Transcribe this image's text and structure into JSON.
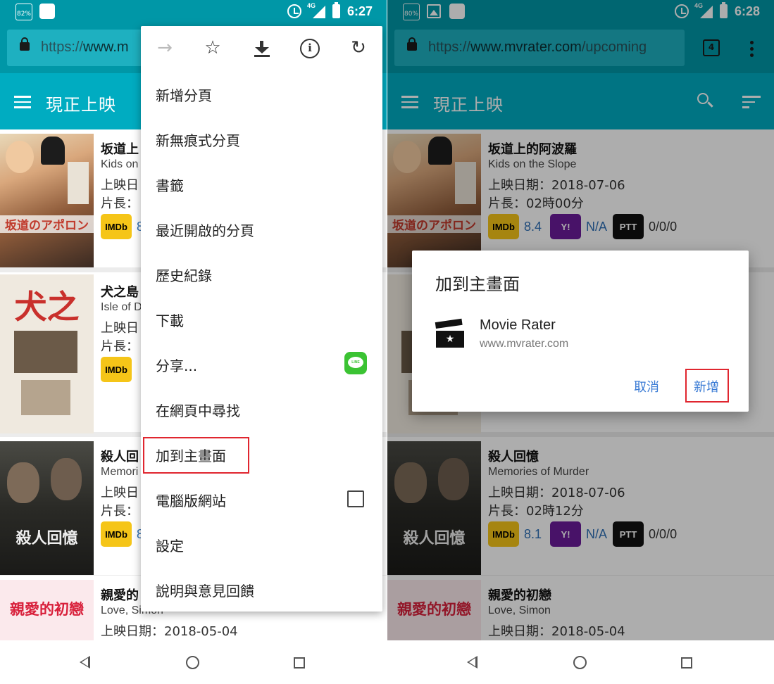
{
  "left": {
    "status": {
      "battery": "82%",
      "time": "6:27",
      "net": "4G"
    },
    "url": {
      "prefix": "https://",
      "domain": "www.m"
    },
    "toolbar": {
      "title": "現正上映"
    },
    "menu": {
      "items": [
        "新增分頁",
        "新無痕式分頁",
        "書籤",
        "最近開啟的分頁",
        "歷史紀錄",
        "下載",
        "分享...",
        "在網頁中尋找",
        "加到主畫面",
        "電腦版網站",
        "設定",
        "說明與意見回饋"
      ],
      "line_label": "LINE"
    },
    "movies": [
      {
        "title": "坂道上",
        "en": "Kids on",
        "date": "上映日",
        "len": "片長：",
        "imdb": "8",
        "poster_text": "坂道のアポロン"
      },
      {
        "title": "犬之島",
        "en": "Isle of D",
        "date": "上映日",
        "len": "片長：",
        "imdb": "",
        "poster_text": "犬之島"
      },
      {
        "title": "殺人回",
        "en": "Memori",
        "date": "上映日",
        "len": "片長：",
        "imdb": "8",
        "poster_text": "殺人回憶"
      },
      {
        "title": "親愛的",
        "en": "Love, Simon",
        "date": "上映日期：2018-05-04",
        "poster_text": "親愛的初戀"
      }
    ]
  },
  "right": {
    "status": {
      "battery": "80%",
      "time": "6:28",
      "net": "4G"
    },
    "url": {
      "prefix": "https://",
      "domain": "www.mvrater.com",
      "path": "/upcoming"
    },
    "tab_count": "4",
    "toolbar": {
      "title": "現正上映"
    },
    "movies": [
      {
        "title": "坂道上的阿波羅",
        "en": "Kids on the Slope",
        "date": "上映日期：2018-07-06",
        "len": "片長：02時00分",
        "imdb": "8.4",
        "y": "N/A",
        "ptt": "0/0/0",
        "poster_text": "坂道のアポロン"
      },
      {
        "title": "殺人回憶",
        "en": "Memories of Murder",
        "date": "上映日期：2018-07-06",
        "len": "片長：02時12分",
        "imdb": "8.1",
        "y": "N/A",
        "ptt": "0/0/0",
        "poster_text": "殺人回憶"
      },
      {
        "title": "親愛的初戀",
        "en": "Love, Simon",
        "date": "上映日期：2018-05-04",
        "poster_text": "親愛的初戀"
      }
    ],
    "dialog": {
      "title": "加到主畫面",
      "app_name": "Movie Rater",
      "app_url": "www.mvrater.com",
      "cancel": "取消",
      "add": "新增"
    }
  },
  "badges": {
    "imdb": "IMDb",
    "y": "Y!",
    "ptt": "PTT"
  },
  "colors": {
    "primary": "#00acc1",
    "primary_dark": "#0097a7",
    "highlight": "#e0262f",
    "link": "#3a7bd5"
  }
}
